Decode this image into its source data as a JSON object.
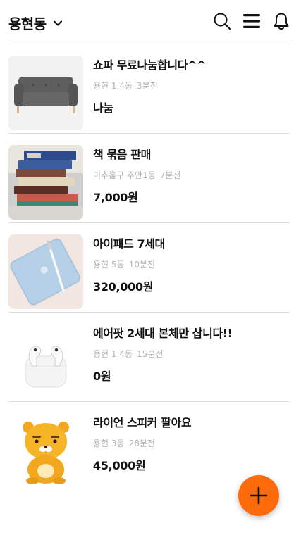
{
  "header": {
    "location": "용현동",
    "icons": [
      "chevron-down-icon",
      "search-icon",
      "menu-icon",
      "bell-icon"
    ]
  },
  "items": [
    {
      "title": "쇼파 무료나눔합니다^^",
      "location": "용현 1,4동",
      "time": "3분전",
      "price": "나눔",
      "image": "gray-sofa"
    },
    {
      "title": "책 묶음 판매",
      "location": "미추홀구 주안1동",
      "time": "7분전",
      "price": "7,000원",
      "image": "stack-of-books"
    },
    {
      "title": "아이패드 7세대",
      "location": "용현 5동",
      "time": "10분전",
      "price": "320,000원",
      "image": "blue-ipad-with-pencil"
    },
    {
      "title": "에어팟 2세대 본체만 삽니다!!",
      "location": "용현 1,4동",
      "time": "15분전",
      "price": "0원",
      "image": "airpods-pro"
    },
    {
      "title": "라이언 스피커 팔아요",
      "location": "용현 3동",
      "time": "28분전",
      "price": "45,000원",
      "image": "ryan-character-speaker"
    }
  ],
  "fab": {
    "icon": "plus-icon"
  },
  "colors": {
    "accent": "#ff6a0a",
    "meta_text": "#b3b3b3",
    "divider": "#dcdcdc"
  }
}
